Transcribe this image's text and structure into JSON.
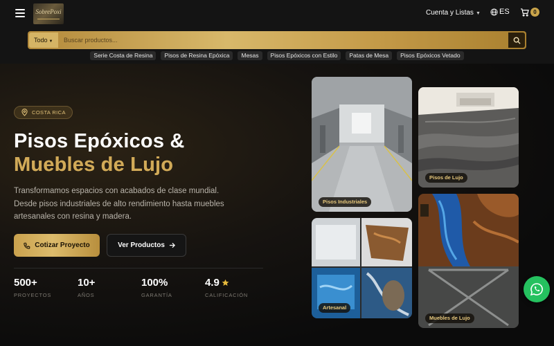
{
  "header": {
    "logo_text": "SobrePoxi",
    "account_label": "Cuenta y Listas",
    "language_label": "ES",
    "cart_count": "0"
  },
  "search": {
    "category_label": "Todo",
    "placeholder": "Buscar productos..."
  },
  "categories": [
    "Serie Costa de Resina",
    "Pisos de Resina Epóxica",
    "Mesas",
    "Pisos Epóxicos con Estilo",
    "Patas de Mesa",
    "Pisos Epóxicos Vetado"
  ],
  "hero": {
    "badge": "COSTA RICA",
    "title_line1": "Pisos Epóxicos &",
    "title_line2": "Muebles de Lujo",
    "description": "Transformamos espacios con acabados de clase mundial. Desde pisos industriales de alto rendimiento hasta muebles artesanales con resina y madera.",
    "cta_primary": "Cotizar Proyecto",
    "cta_secondary": "Ver Productos"
  },
  "stats": [
    {
      "value": "500+",
      "label": "PROYECTOS"
    },
    {
      "value": "10+",
      "label": "AÑOS"
    },
    {
      "value": "100%",
      "label": "GARANTÍA"
    },
    {
      "value": "4.9",
      "label": "CALIFICACIÓN",
      "icon": "star-icon"
    }
  ],
  "gallery": [
    {
      "label": "Pisos Industriales"
    },
    {
      "label": "Pisos de Lujo"
    },
    {
      "label": "Artesanal"
    },
    {
      "label": "Muebles de Lujo"
    }
  ],
  "colors": {
    "gold": "#c9a44a",
    "background": "#0d0d0d",
    "whatsapp": "#25c15f"
  }
}
